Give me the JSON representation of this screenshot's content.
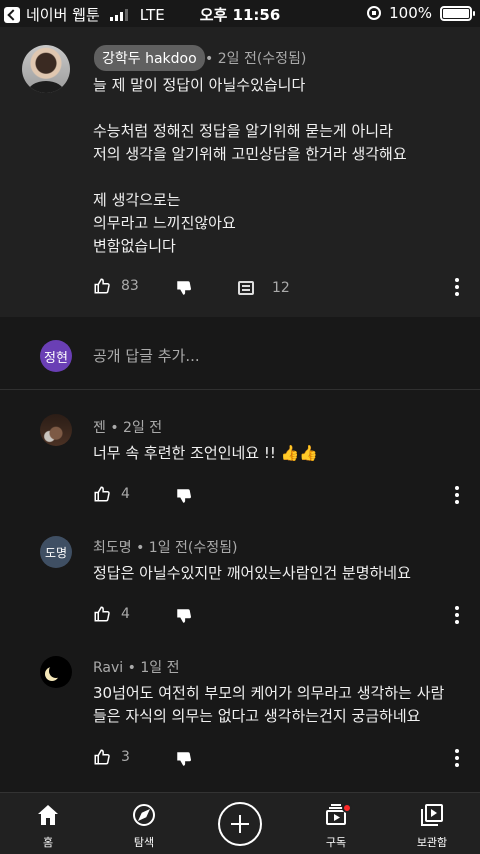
{
  "status_bar": {
    "back_app": "네이버 웹툰",
    "network": "LTE",
    "time": "오후 11:56",
    "battery": "100%",
    "battery_level": 1.0
  },
  "main_comment": {
    "author": "강학두 hakdoo",
    "time": "• 2일 전(수정됨)",
    "text": "늘 제 말이 정답이 아닐수있습니다\n\n수능처럼 정해진 정답을 알기위해 묻는게 아니라\n저의 생각을 알기위해 고민상담을 한거라 생각해요\n\n제 생각으로는\n의무라고 느끼진않아요\n변함없습니다",
    "likes": "83",
    "replies": "12"
  },
  "reply_input": {
    "avatar_text": "정현",
    "placeholder": "공개 답글 추가..."
  },
  "replies": [
    {
      "author": "젠",
      "time": "• 2일 전",
      "text": "너무 속 후련한 조언인네요 !! 👍👍",
      "likes": "4"
    },
    {
      "author": "최도명",
      "avatar_text": "도명",
      "time": "• 1일 전(수정됨)",
      "text": "정답은 아닐수있지만 깨어있는사람인건 분명하네요",
      "likes": "4"
    },
    {
      "author": "Ravi",
      "time": "• 1일 전",
      "text": "30넘어도 여전히 부모의 케어가 의무라고 생각하는 사람\n들은 자식의 의무는 없다고 생각하는건지 궁금하네요",
      "likes": "3"
    }
  ],
  "bottom_nav": [
    {
      "label": "홈",
      "icon": "home-icon"
    },
    {
      "label": "탐색",
      "icon": "compass-icon"
    },
    {
      "label": "",
      "icon": "create-icon"
    },
    {
      "label": "구독",
      "icon": "subscriptions-icon"
    },
    {
      "label": "보관함",
      "icon": "library-icon"
    }
  ]
}
